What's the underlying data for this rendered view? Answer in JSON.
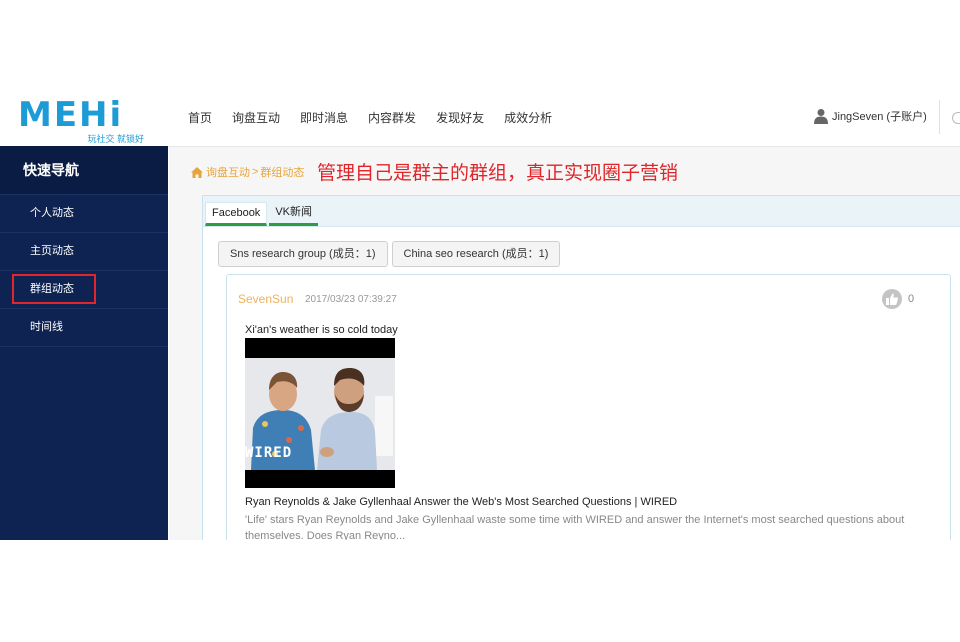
{
  "logo": {
    "wordmark": "MEHi",
    "tagline": "玩社交 就锁好"
  },
  "nav": {
    "items": [
      "首页",
      "询盘互动",
      "即时消息",
      "内容群发",
      "发现好友",
      "成效分析"
    ]
  },
  "user": {
    "name": "JingSeven (子账户)"
  },
  "sidebar": {
    "title": "快速导航",
    "items": [
      {
        "label": "个人动态"
      },
      {
        "label": "主页动态"
      },
      {
        "label": "群组动态"
      },
      {
        "label": "时间线"
      }
    ]
  },
  "breadcrumb": {
    "parent": "询盘互动",
    "separator": ">",
    "current": "群组动态"
  },
  "annotation": "管理自己是群主的群组，真正实现圈子营销",
  "tabs": [
    {
      "label": "Facebook"
    },
    {
      "label": "VK新闻"
    }
  ],
  "groups": [
    {
      "label": "Sns research group (成员：1)"
    },
    {
      "label": "China seo research (成员：1)"
    }
  ],
  "post": {
    "author": "SevenSun",
    "time": "2017/03/23 07:39:27",
    "likes": "0",
    "text": "Xi'an's weather is so cold today",
    "media_watermark": "WIRED",
    "link_title": "Ryan Reynolds & Jake Gyllenhaal Answer the Web's Most Searched Questions | WIRED",
    "link_desc": "'Life' stars Ryan Reynolds and Jake Gyllenhaal waste some time with WIRED and answer the Internet's most searched questions about themselves. Does Ryan Reyno..."
  },
  "colors": {
    "accent": "#1d9bd7",
    "sidebar": "#0e2352",
    "highlight": "#e0262a",
    "author": "#f0b15c",
    "tab_underline": "#2e9b47"
  }
}
